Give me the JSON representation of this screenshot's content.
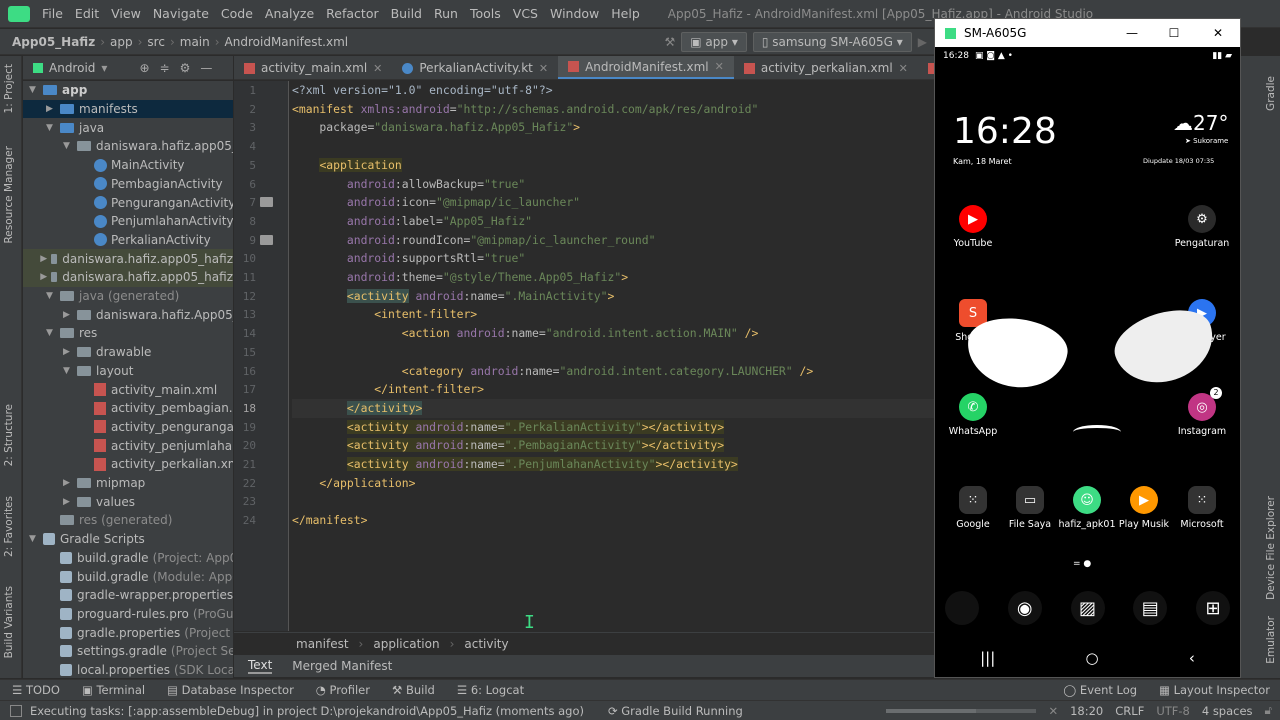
{
  "menu": {
    "items": [
      "File",
      "Edit",
      "View",
      "Navigate",
      "Code",
      "Analyze",
      "Refactor",
      "Build",
      "Run",
      "Tools",
      "VCS",
      "Window",
      "Help"
    ],
    "window_title": "App05_Hafiz - AndroidManifest.xml [App05_Hafiz.app] - Android Studio"
  },
  "nav": {
    "crumbs": [
      "App05_Hafiz",
      "app",
      "src",
      "main",
      "AndroidManifest.xml"
    ],
    "run_config": "app",
    "device": "samsung SM-A605G"
  },
  "left_strip": {
    "labels": [
      "1: Project",
      "Resource Manager",
      "2: Structure",
      "2: Favorites",
      "Build Variants"
    ]
  },
  "project": {
    "view_label": "Android",
    "tree": [
      {
        "label": "app",
        "indent": 0,
        "icon": "folder-icon",
        "exp": "▼",
        "style": "bold"
      },
      {
        "label": "manifests",
        "indent": 1,
        "icon": "folder-icon",
        "exp": "▶",
        "style": "sel"
      },
      {
        "label": "java",
        "indent": 1,
        "icon": "folder-icon",
        "exp": "▼"
      },
      {
        "label": "daniswara.hafiz.app05_hafiz",
        "indent": 2,
        "icon": "folder-icon",
        "exp": "▼"
      },
      {
        "label": "MainActivity",
        "indent": 3,
        "icon": "kotlin-class-icon"
      },
      {
        "label": "PembagianActivity",
        "indent": 3,
        "icon": "kotlin-class-icon"
      },
      {
        "label": "PenguranganActivity",
        "indent": 3,
        "icon": "kotlin-class-icon"
      },
      {
        "label": "PenjumlahanActivity",
        "indent": 3,
        "icon": "kotlin-class-icon"
      },
      {
        "label": "PerkalianActivity",
        "indent": 3,
        "icon": "kotlin-class-icon"
      },
      {
        "label": "daniswara.hafiz.app05_hafiz",
        "indent": 2,
        "icon": "folder-icon",
        "exp": "▶",
        "style": "gen"
      },
      {
        "label": "daniswara.hafiz.app05_hafiz",
        "indent": 2,
        "icon": "folder-icon",
        "exp": "▶",
        "style": "gen"
      },
      {
        "label": "java (generated)",
        "indent": 1,
        "icon": "folder-icon",
        "exp": "▼",
        "style": "muted"
      },
      {
        "label": "daniswara.hafiz.App05_Hafiz",
        "indent": 2,
        "icon": "folder-icon",
        "exp": "▶"
      },
      {
        "label": "res",
        "indent": 1,
        "icon": "folder-icon",
        "exp": "▼"
      },
      {
        "label": "drawable",
        "indent": 2,
        "icon": "folder-icon",
        "exp": "▶"
      },
      {
        "label": "layout",
        "indent": 2,
        "icon": "folder-icon",
        "exp": "▼"
      },
      {
        "label": "activity_main.xml",
        "indent": 3,
        "icon": "xml-file-icon"
      },
      {
        "label": "activity_pembagian.xml",
        "indent": 3,
        "icon": "xml-file-icon"
      },
      {
        "label": "activity_pengurangan.xml",
        "indent": 3,
        "icon": "xml-file-icon"
      },
      {
        "label": "activity_penjumlahan.xml",
        "indent": 3,
        "icon": "xml-file-icon"
      },
      {
        "label": "activity_perkalian.xml",
        "indent": 3,
        "icon": "xml-file-icon"
      },
      {
        "label": "mipmap",
        "indent": 2,
        "icon": "folder-icon",
        "exp": "▶"
      },
      {
        "label": "values",
        "indent": 2,
        "icon": "folder-icon",
        "exp": "▶"
      },
      {
        "label": "res (generated)",
        "indent": 1,
        "icon": "folder-icon",
        "style": "muted"
      },
      {
        "label": "Gradle Scripts",
        "indent": 0,
        "icon": "gradle-icon",
        "exp": "▼"
      },
      {
        "label": "build.gradle",
        "indent": 1,
        "icon": "gradle-icon",
        "note": "(Project: App05_Ha"
      },
      {
        "label": "build.gradle",
        "indent": 1,
        "icon": "gradle-icon",
        "note": "(Module: App05_H"
      },
      {
        "label": "gradle-wrapper.properties",
        "indent": 1,
        "icon": "gradle-icon",
        "note": "(Grad"
      },
      {
        "label": "proguard-rules.pro",
        "indent": 1,
        "icon": "gradle-icon",
        "note": "(ProGuard R"
      },
      {
        "label": "gradle.properties",
        "indent": 1,
        "icon": "gradle-icon",
        "note": "(Project Prope"
      },
      {
        "label": "settings.gradle",
        "indent": 1,
        "icon": "gradle-icon",
        "note": "(Project Settings"
      },
      {
        "label": "local.properties",
        "indent": 1,
        "icon": "gradle-icon",
        "note": "(SDK Location)"
      }
    ]
  },
  "editor": {
    "tabs": [
      {
        "label": "activity_main.xml",
        "active": false
      },
      {
        "label": "PerkalianActivity.kt",
        "active": false
      },
      {
        "label": "AndroidManifest.xml",
        "active": true
      },
      {
        "label": "activity_perkalian.xml",
        "active": false
      },
      {
        "label": "activity_pembagia",
        "active": false
      }
    ],
    "current_line": 18,
    "lines": [
      [
        [
          "<?xml version=\"1.0\" encoding=\"utf-8\"?>",
          "plain"
        ]
      ],
      [
        [
          "<manifest ",
          "tag"
        ],
        [
          "xmlns:",
          "ns"
        ],
        [
          "android",
          "ns"
        ],
        [
          "=",
          "attr"
        ],
        [
          "\"http://schemas.android.com/apk/res/android\"",
          "str"
        ]
      ],
      [
        [
          "    package",
          "attr"
        ],
        [
          "=",
          "attr"
        ],
        [
          "\"daniswara.hafiz.App05_Hafiz\"",
          "str"
        ],
        [
          ">",
          "tag"
        ]
      ],
      [],
      [
        [
          "    ",
          "plain"
        ],
        [
          "<application",
          "tag",
          "hl-yellow"
        ]
      ],
      [
        [
          "        android",
          "ns"
        ],
        [
          ":allowBackup=",
          "attr"
        ],
        [
          "\"true\"",
          "str"
        ]
      ],
      [
        [
          "        android",
          "ns"
        ],
        [
          ":icon=",
          "attr"
        ],
        [
          "\"@mipmap/ic_launcher\"",
          "str"
        ]
      ],
      [
        [
          "        android",
          "ns"
        ],
        [
          ":label=",
          "attr"
        ],
        [
          "\"App05_Hafiz\"",
          "str"
        ]
      ],
      [
        [
          "        android",
          "ns"
        ],
        [
          ":roundIcon=",
          "attr"
        ],
        [
          "\"@mipmap/ic_launcher_round\"",
          "str"
        ]
      ],
      [
        [
          "        android",
          "ns"
        ],
        [
          ":supportsRtl=",
          "attr"
        ],
        [
          "\"true\"",
          "str"
        ]
      ],
      [
        [
          "        android",
          "ns"
        ],
        [
          ":theme=",
          "attr"
        ],
        [
          "\"@style/Theme.App05_Hafiz\"",
          "str"
        ],
        [
          ">",
          "tag"
        ]
      ],
      [
        [
          "        ",
          "plain"
        ],
        [
          "<activity",
          "tag",
          "hl-tag"
        ],
        [
          " android",
          "ns"
        ],
        [
          ":name=",
          "attr"
        ],
        [
          "\".MainActivity\"",
          "str"
        ],
        [
          ">",
          "tag"
        ]
      ],
      [
        [
          "            <intent-filter>",
          "tag"
        ]
      ],
      [
        [
          "                <action ",
          "tag"
        ],
        [
          "android",
          "ns"
        ],
        [
          ":name=",
          "attr"
        ],
        [
          "\"android.intent.action.MAIN\"",
          "str"
        ],
        [
          " />",
          "tag"
        ]
      ],
      [],
      [
        [
          "                <category ",
          "tag"
        ],
        [
          "android",
          "ns"
        ],
        [
          ":name=",
          "attr"
        ],
        [
          "\"android.intent.category.LAUNCHER\"",
          "str"
        ],
        [
          " />",
          "tag"
        ]
      ],
      [
        [
          "            </intent-filter>",
          "tag"
        ]
      ],
      [
        [
          "        ",
          "plain"
        ],
        [
          "</activity>",
          "tag",
          "hl-tag"
        ]
      ],
      [
        [
          "        ",
          "plain"
        ],
        [
          "<activity ",
          "tag",
          "hl-yellow"
        ],
        [
          "android",
          "ns",
          "hl-yellow"
        ],
        [
          ":name=",
          "attr",
          "hl-yellow"
        ],
        [
          "\".PerkalianActivity\"",
          "str",
          "hl-yellow"
        ],
        [
          "></activity>",
          "tag",
          "hl-yellow"
        ]
      ],
      [
        [
          "        ",
          "plain"
        ],
        [
          "<activity ",
          "tag",
          "hl-yellow"
        ],
        [
          "android",
          "ns",
          "hl-yellow"
        ],
        [
          ":name=",
          "attr",
          "hl-yellow"
        ],
        [
          "\".PembagianActivity\"",
          "str",
          "hl-yellow"
        ],
        [
          "></activity>",
          "tag",
          "hl-yellow"
        ]
      ],
      [
        [
          "        ",
          "plain"
        ],
        [
          "<activity ",
          "tag",
          "hl-yellow"
        ],
        [
          "android",
          "ns",
          "hl-yellow"
        ],
        [
          ":name=",
          "attr",
          "hl-yellow"
        ],
        [
          "\".PenjumlahanActivity\"",
          "str",
          "hl-yellow"
        ],
        [
          "></activity>",
          "tag",
          "hl-yellow"
        ]
      ],
      [
        [
          "    </application>",
          "tag"
        ]
      ],
      [],
      [
        [
          "</manifest>",
          "tag"
        ]
      ]
    ],
    "breadcrumbs": [
      "manifest",
      "application",
      "activity"
    ],
    "bottom_tabs": [
      "Text",
      "Merged Manifest"
    ]
  },
  "tool_windows": [
    "TODO",
    "Terminal",
    "Database Inspector",
    "Profiler",
    "Build",
    "6: Logcat",
    "Event Log",
    "Layout Inspector"
  ],
  "right_strip": {
    "labels": [
      "Gradle",
      "Device File Explorer",
      "Emulator"
    ]
  },
  "status": {
    "message": "Executing tasks: [:app:assembleDebug] in project D:\\projekandroid\\App05_Hafiz (moments ago)",
    "task": "Gradle Build Running",
    "position": "18:20",
    "line_sep": "CRLF",
    "encoding": "UTF-8",
    "indent": "4 spaces"
  },
  "phone": {
    "window_title": "SM-A605G",
    "status_time": "16:28",
    "clock": "16:28",
    "date": "Kam, 18 Maret",
    "weather_temp": "27°",
    "weather_loc": "Sukorame",
    "weather_updated": "Diupdate 18/03 07:35",
    "apps": [
      {
        "label": "YouTube",
        "icon": "youtube-icon",
        "color": "#ff0000",
        "glyph": "▶"
      },
      {
        "label": "Pengaturan",
        "icon": "settings-icon",
        "color": "#2a2a2a",
        "glyph": "⚙"
      },
      {
        "label": "Shopee",
        "icon": "shopee-icon",
        "color": "#ee4d2d",
        "glyph": "S"
      },
      {
        "label": "MX Player",
        "icon": "mxplayer-icon",
        "color": "#2b74f0",
        "glyph": "▶"
      },
      {
        "label": "WhatsApp",
        "icon": "whatsapp-icon",
        "color": "#25d366",
        "glyph": "✆"
      },
      {
        "label": "Instagram",
        "icon": "instagram-icon",
        "color": "#c13584",
        "glyph": "◎",
        "badge": "2"
      },
      {
        "label": "Google",
        "icon": "google-folder-icon",
        "color": "#333333",
        "glyph": "⁙"
      },
      {
        "label": "File Saya",
        "icon": "files-icon",
        "color": "#333333",
        "glyph": "▭"
      },
      {
        "label": "hafiz_apk01",
        "icon": "android-app-icon",
        "color": "#3ddc84",
        "glyph": "☺"
      },
      {
        "label": "Play Musik",
        "icon": "play-music-icon",
        "color": "#ff9800",
        "glyph": "▶"
      },
      {
        "label": "Microsoft",
        "icon": "microsoft-folder-icon",
        "color": "#333333",
        "glyph": "⁙"
      }
    ],
    "dock": [
      "phone-icon",
      "camera-icon",
      "gallery-icon",
      "messages-icon",
      "apps-grid-icon"
    ]
  }
}
